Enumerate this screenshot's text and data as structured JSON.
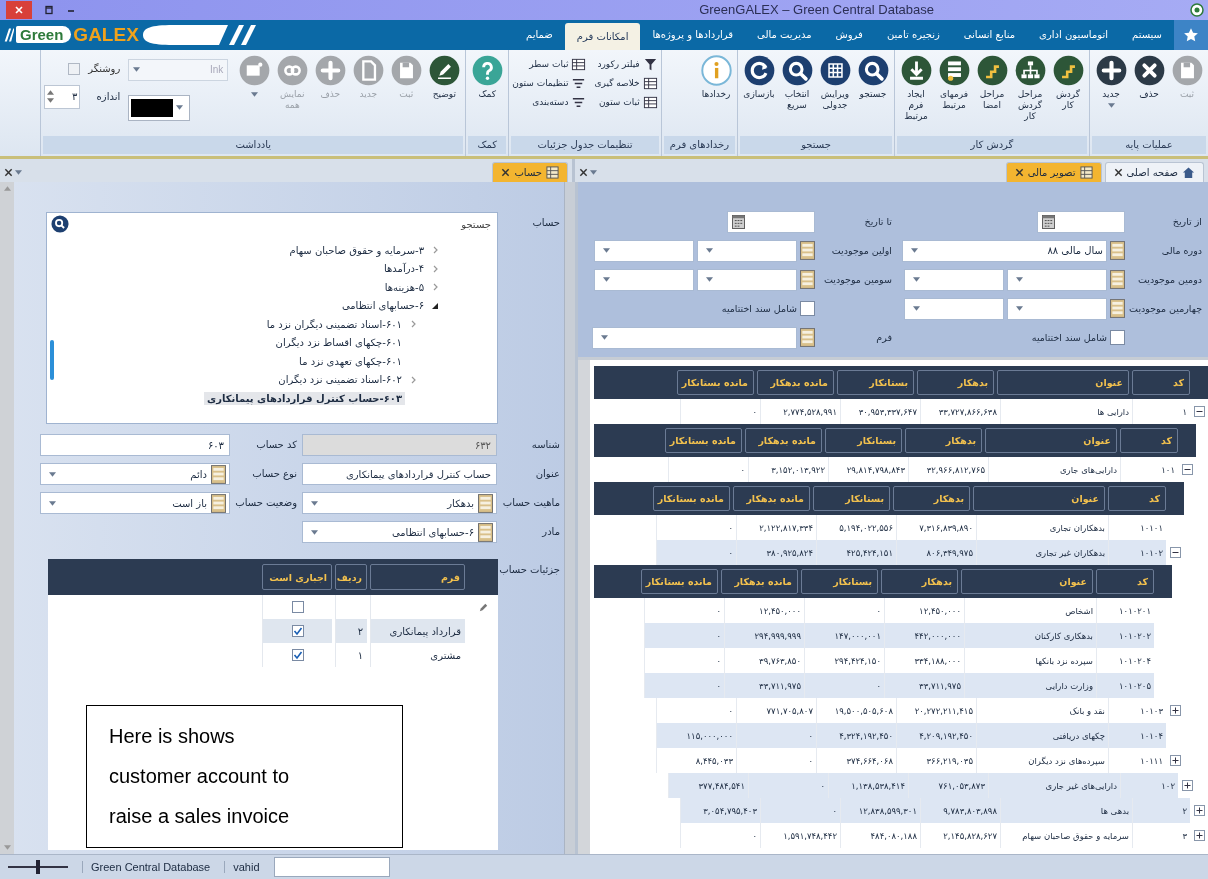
{
  "window": {
    "title": "GreenGALEX – Green Central Database"
  },
  "logo": {
    "first": "Green",
    "second": "GALEX"
  },
  "menu_tabs": [
    {
      "label": "سیستم",
      "selected": false
    },
    {
      "label": "اتوماسیون اداری",
      "selected": false
    },
    {
      "label": "منابع انسانی",
      "selected": false
    },
    {
      "label": "زنجیره تامین",
      "selected": false
    },
    {
      "label": "فروش",
      "selected": false
    },
    {
      "label": "مدیریت مالی",
      "selected": false
    },
    {
      "label": "قراردادها و پروژه‌ها",
      "selected": false
    },
    {
      "label": "امکانات فرم",
      "selected": true
    },
    {
      "label": "ضمایم",
      "selected": false
    }
  ],
  "ribbon": [
    {
      "title": "عملیات پایه",
      "kind": "big",
      "buttons": [
        {
          "label": "ثبت",
          "disabled": true
        },
        {
          "label": "حذف",
          "disabled": false
        },
        {
          "label": "جدید",
          "disabled": false,
          "dropdown": true
        }
      ]
    },
    {
      "title": "گردش کار",
      "kind": "big",
      "buttons": [
        {
          "label": "گردش کار",
          "disabled": false
        },
        {
          "label": "مراحل گردش کار",
          "disabled": false
        },
        {
          "label": "مراحل امضا",
          "disabled": false
        },
        {
          "label": "فرمهای مرتبط",
          "disabled": false
        },
        {
          "label": "ایجاد فرم مرتبط",
          "disabled": false
        }
      ]
    },
    {
      "title": "جستجو",
      "kind": "big",
      "buttons": [
        {
          "label": "جستجو",
          "disabled": false
        },
        {
          "label": "ویرایش جدولی",
          "disabled": false
        },
        {
          "label": "انتخاب سریع",
          "disabled": false
        },
        {
          "label": "بازسازی",
          "disabled": false
        }
      ]
    },
    {
      "title": "رخدادهای فرم",
      "kind": "big",
      "buttons": [
        {
          "label": "رخدادها",
          "disabled": false
        }
      ]
    },
    {
      "title": "تنظیمات جدول جزئیات",
      "kind": "small",
      "buttons": [
        {
          "label": "فیلتر رکورد",
          "disabled": false
        },
        {
          "label": "ثبات سطر",
          "disabled": false
        },
        {
          "label": "خلاصه گیری",
          "disabled": false
        },
        {
          "label": "تنظیمات ستون",
          "disabled": false
        },
        {
          "label": "ثبات ستون",
          "disabled": false
        },
        {
          "label": "دسته‌بندی",
          "disabled": false
        }
      ]
    },
    {
      "title": "کمک",
      "kind": "big",
      "buttons": [
        {
          "label": "کمک",
          "disabled": false
        }
      ]
    },
    {
      "title": "یادداشت",
      "kind": "notes",
      "buttons": [
        {
          "label": "توضیح",
          "disabled": false
        },
        {
          "label": "ثبت",
          "disabled": true
        },
        {
          "label": "جدید",
          "disabled": true
        },
        {
          "label": "حذف",
          "disabled": true
        },
        {
          "label": "نمایش همه",
          "disabled": true
        },
        {
          "disabled": true,
          "dropdown": true
        }
      ],
      "ink": {
        "value": "Ink",
        "disabled": true
      },
      "highlighter": {
        "label": "روشنگر",
        "checked": false,
        "disabled": true
      },
      "size": {
        "label": "اندازه",
        "value": "۳"
      }
    }
  ],
  "left_tabs": [
    {
      "label": "حساب",
      "selected": true,
      "kind": "form"
    }
  ],
  "right_tabs": [
    {
      "label": "صفحه اصلی",
      "selected": false,
      "kind": "home"
    },
    {
      "label": "تصویر مالی",
      "selected": true,
      "kind": "form"
    }
  ],
  "account_form": {
    "tree_label": "حساب",
    "search_placeholder": "جستجو",
    "tree": [
      {
        "label": "۳-سرمایه و حقوق صاحبان سهام",
        "expanded": false,
        "selected": false
      },
      {
        "label": "۴-درآمدها",
        "expanded": false,
        "selected": false
      },
      {
        "label": "۵-هزینه‌ها",
        "expanded": false,
        "selected": false
      },
      {
        "label": "۶-حسابهای انتظامی",
        "expanded": true,
        "selected": false,
        "children": [
          {
            "label": "۶۰۱-اسناد تضمینی دیگران نزد ما",
            "expanded": false,
            "selected": false
          },
          {
            "label": "۶۰۱-چکهای اقساط نزد دیگران",
            "selected": false
          },
          {
            "label": "۶۰۱-چکهای تعهدی نزد ما",
            "selected": false
          },
          {
            "label": "۶۰۲-اسناد تضمینی نزد دیگران",
            "expanded": false,
            "selected": false
          },
          {
            "label": "۶۰۳-حساب کنترل قراردادهای پیمانکاری",
            "selected": true
          }
        ]
      }
    ],
    "fields": [
      {
        "label": "شناسه",
        "kind": "text",
        "value": "۶۳۲",
        "disabled": true
      },
      {
        "label": "کد حساب",
        "kind": "text",
        "value": "۶۰۳",
        "disabled": false
      },
      {
        "label": "عنوان",
        "kind": "text",
        "value": "حساب کنترل قراردادهای پیمانکاری",
        "disabled": false
      },
      {
        "label": "نوع حساب",
        "kind": "combo",
        "value": "دائم"
      },
      {
        "label": "ماهیت حساب",
        "kind": "combo",
        "value": "بدهکار"
      },
      {
        "label": "وضعیت حساب",
        "kind": "combo",
        "value": "باز است"
      },
      {
        "label": "مادر",
        "kind": "combo",
        "value": "۶-حسابهای انتظامی"
      }
    ],
    "details_label": "جزئیات حساب",
    "details_columns": [
      "فرم",
      "ردیف",
      "اجباری است"
    ],
    "details_rows": [
      {
        "kind": "new",
        "required": false,
        "selected": false
      },
      {
        "kind": "row",
        "form": "قرارداد پیمانکاری",
        "row": "۲",
        "required": true,
        "selected": true
      },
      {
        "kind": "row",
        "form": "مشتری",
        "row": "۱",
        "required": true,
        "selected": false
      }
    ]
  },
  "annotation": {
    "text": "Here is shows customer account to raise a sales invoice"
  },
  "filters": [
    {
      "label": "از تاریخ",
      "kind": "date"
    },
    {
      "label": "تا تاریخ",
      "kind": "date"
    },
    {
      "label": "دوره مالی",
      "kind": "combo",
      "value": "سال مالی ۸۸"
    },
    {
      "label": "اولین موجودیت",
      "kind": "combo2"
    },
    {
      "label": "دومین موجودیت",
      "kind": "combo2"
    },
    {
      "label": "سومین موجودیت",
      "kind": "combo2"
    },
    {
      "label": "چهارمین موجودیت",
      "kind": "combo2"
    },
    {
      "label": "شامل سند اختتامیه",
      "kind": "checkbox",
      "checked": false
    },
    {
      "label": "شامل سند اختتامیه",
      "kind": "checkbox",
      "checked": false
    },
    {
      "label": "فرم",
      "kind": "combo"
    }
  ],
  "accounts": {
    "columns": [
      "کد",
      "عنوان",
      "بدهکار",
      "بستانکار",
      "مانده بدهکار",
      "مانده بستانکار"
    ],
    "rows": [
      {
        "code": "۱",
        "title": "دارایی ها",
        "debit": "۳۳,۷۲۷,۸۶۶,۶۳۸",
        "credit": "۳۰,۹۵۳,۳۳۷,۶۴۷",
        "balance_debit": "۲,۷۷۴,۵۲۸,۹۹۱",
        "balance_credit": "۰",
        "expanded": true,
        "columns": [
          "کد",
          "عنوان",
          "بدهکار",
          "بستانکار",
          "مانده بدهکار",
          "مانده بستانکار"
        ],
        "children": [
          {
            "code": "۱۰۱",
            "title": "دارایی‌های جاری",
            "debit": "۳۲,۹۶۶,۸۱۲,۷۶۵",
            "credit": "۲۹,۸۱۴,۷۹۸,۸۴۳",
            "balance_debit": "۳,۱۵۲,۰۱۳,۹۲۲",
            "balance_credit": "۰",
            "expanded": true,
            "columns": [
              "کد",
              "عنوان",
              "بدهکار",
              "بستانکار",
              "مانده بدهکار",
              "مانده بستانکار"
            ],
            "children": [
              {
                "code": "۱۰۱۰۱",
                "title": "بدهکاران تجاری",
                "debit": "۷,۳۱۶,۸۳۹,۸۹۰",
                "credit": "۵,۱۹۴,۰۲۲,۵۵۶",
                "balance_debit": "۲,۱۲۲,۸۱۷,۳۳۴",
                "balance_credit": "۰"
              },
              {
                "code": "۱۰۱۰۲",
                "title": "بدهکاران غیر تجاری",
                "debit": "۸۰۶,۳۴۹,۹۷۵",
                "credit": "۴۲۵,۴۲۴,۱۵۱",
                "balance_debit": "۳۸۰,۹۲۵,۸۲۴",
                "balance_credit": "۰",
                "expanded": true,
                "columns": [
                  "کد",
                  "عنوان",
                  "بدهکار",
                  "بستانکار",
                  "مانده بدهکار",
                  "مانده بستانکار"
                ],
                "children": [
                  {
                    "code": "۱۰۱۰۲۰۱",
                    "title": "اشخاص",
                    "debit": "۱۲,۴۵۰,۰۰۰",
                    "credit": "۰",
                    "balance_debit": "۱۲,۴۵۰,۰۰۰",
                    "balance_credit": "۰"
                  },
                  {
                    "code": "۱۰۱۰۲۰۲",
                    "title": "بدهکاری کارکنان",
                    "debit": "۴۴۲,۰۰۰,۰۰۰",
                    "credit": "۱۴۷,۰۰۰,۰۰۱",
                    "balance_debit": "۲۹۴,۹۹۹,۹۹۹",
                    "balance_credit": "۰"
                  },
                  {
                    "code": "۱۰۱۰۲۰۴",
                    "title": "سپرده نزد بانکها",
                    "debit": "۳۳۴,۱۸۸,۰۰۰",
                    "credit": "۲۹۴,۴۲۴,۱۵۰",
                    "balance_debit": "۳۹,۷۶۳,۸۵۰",
                    "balance_credit": "۰"
                  },
                  {
                    "code": "۱۰۱۰۲۰۵",
                    "title": "وزارت دارایی",
                    "debit": "۳۳,۷۱۱,۹۷۵",
                    "credit": "۰",
                    "balance_debit": "۳۳,۷۱۱,۹۷۵",
                    "balance_credit": "۰"
                  }
                ]
              },
              {
                "code": "۱۰۱۰۳",
                "title": "نقد و بانک",
                "debit": "۲۰,۲۷۲,۲۱۱,۴۱۵",
                "credit": "۱۹,۵۰۰,۵۰۵,۶۰۸",
                "balance_debit": "۷۷۱,۷۰۵,۸۰۷",
                "balance_credit": "۰",
                "expanded": false
              },
              {
                "code": "۱۰۱۰۴",
                "title": "چکهای دریافتی",
                "debit": "۴,۲۰۹,۱۹۲,۴۵۰",
                "credit": "۴,۳۲۴,۱۹۲,۴۵۰",
                "balance_debit": "۰",
                "balance_credit": "۱۱۵,۰۰۰,۰۰۰"
              },
              {
                "code": "۱۰۱۱۱",
                "title": "سپرده‌های نزد دیگران",
                "debit": "۳۶۶,۲۱۹,۰۳۵",
                "credit": "۳۷۴,۶۶۴,۰۶۸",
                "balance_debit": "۰",
                "balance_credit": "۸,۴۴۵,۰۳۳",
                "expanded": false
              }
            ]
          },
          {
            "code": "۱۰۲",
            "title": "دارایی‌های غیر جاری",
            "debit": "۷۶۱,۰۵۳,۸۷۳",
            "credit": "۱,۱۳۸,۵۳۸,۴۱۴",
            "balance_debit": "۰",
            "balance_credit": "۳۷۷,۴۸۴,۵۴۱",
            "expanded": false
          }
        ]
      },
      {
        "code": "۲",
        "title": "بدهی ها",
        "debit": "۹,۷۸۳,۸۰۳,۸۹۸",
        "credit": "۱۲,۸۳۸,۵۹۹,۳۰۱",
        "balance_debit": "۰",
        "balance_credit": "۳,۰۵۴,۷۹۵,۴۰۳",
        "expanded": false
      },
      {
        "code": "۳",
        "title": "سرمایه و حقوق صاحبان سهام",
        "debit": "۲,۱۴۵,۸۲۸,۶۲۷",
        "credit": "۴۸۴,۰۸۰,۱۸۸",
        "balance_debit": "۱,۵۹۱,۷۴۸,۴۴۲",
        "balance_credit": "۰",
        "expanded": false
      }
    ]
  },
  "status_bar": {
    "zoom": {
      "level": 0.5
    },
    "items": [
      "vahid",
      "Green Central Database"
    ]
  }
}
